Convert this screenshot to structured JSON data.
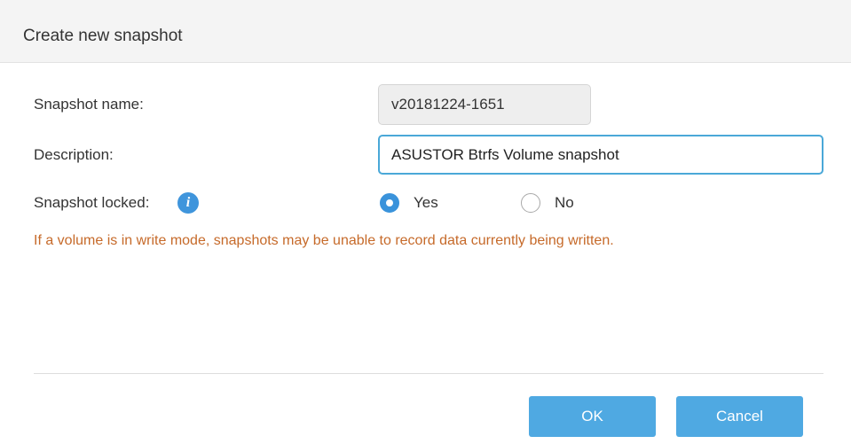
{
  "dialog": {
    "title": "Create new snapshot"
  },
  "form": {
    "snapshot_name_label": "Snapshot name:",
    "snapshot_name_value": "v20181224-1651",
    "description_label": "Description:",
    "description_value": "ASUSTOR Btrfs Volume snapshot",
    "locked_label": "Snapshot locked:",
    "info_icon_glyph": "i",
    "locked_options": [
      {
        "label": "Yes",
        "checked": true
      },
      {
        "label": "No",
        "checked": false
      }
    ],
    "warning": "If a volume is in write mode, snapshots may be unable to record data currently being written."
  },
  "buttons": {
    "ok_label": "OK",
    "cancel_label": "Cancel"
  },
  "colors": {
    "accent": "#4fa9e2",
    "warning": "#c66a2a",
    "radio_checked": "#3a93db"
  }
}
